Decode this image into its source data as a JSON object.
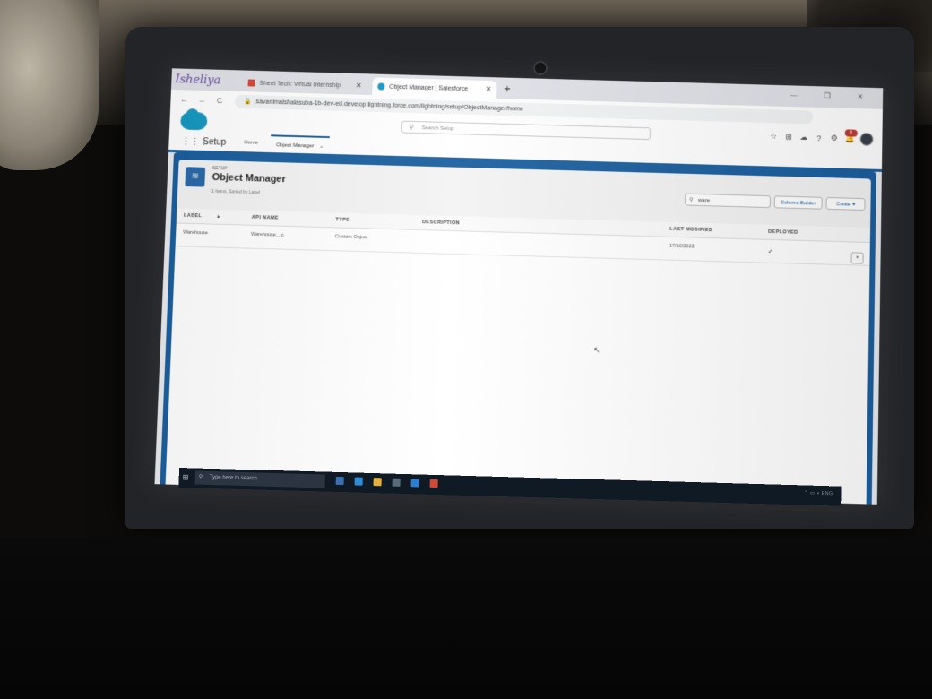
{
  "browser": {
    "tab_scribble": "Isheliya",
    "tabs": [
      {
        "label": "Sheet Tech: Virtual Internship",
        "close": "✕"
      },
      {
        "label": "Object Manager | Salesforce",
        "close": "✕"
      }
    ],
    "new_tab": "+",
    "window_controls": "— ❐ ✕",
    "nav": {
      "back": "←",
      "forward": "→",
      "reload": "C"
    },
    "url": "savanimalshalasuba-1b-dev-ed.develop.lightning.force.com/lightning/setup/ObjectManager/home"
  },
  "sf_header": {
    "search_placeholder": "Search Setup",
    "notification_count": "3"
  },
  "setup_nav": {
    "app_name": "Setup",
    "home": "Home",
    "object_manager": "Object Manager"
  },
  "page_header": {
    "eyebrow": "SETUP",
    "title": "Object Manager",
    "meta": "1 Items, Sorted by Label",
    "quick_find_value": "ware",
    "schema_builder": "Schema Builder",
    "create": "Create"
  },
  "table": {
    "columns": [
      "LABEL",
      "API NAME",
      "TYPE",
      "DESCRIPTION",
      "LAST MODIFIED",
      "DEPLOYED"
    ],
    "rows": [
      {
        "label": "Warehouse",
        "api_name": "Warehouse__c",
        "type": "Custom Object",
        "description": "",
        "last_modified": "17/10/2023",
        "deployed": "✓"
      }
    ]
  },
  "taskbar": {
    "search_placeholder": "Type here to search"
  },
  "colors": {
    "brand_blue": "#1798c1",
    "header_band": "#1b5f9e",
    "notification_red": "#c23934"
  }
}
